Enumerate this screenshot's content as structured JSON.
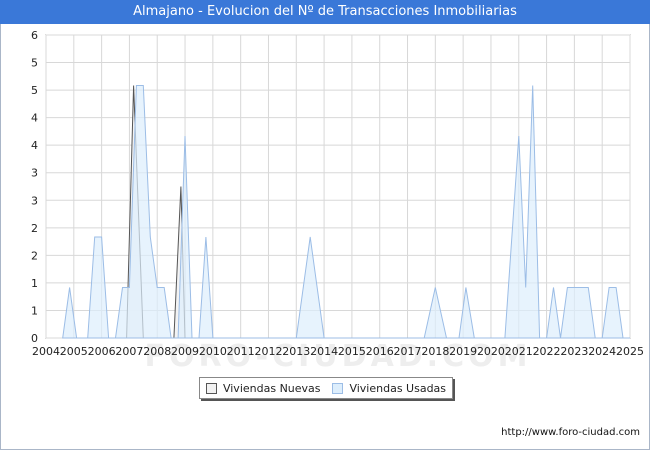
{
  "title": "Almajano - Evolucion del Nº de Transacciones Inmobiliarias",
  "footer": "http://www.foro-ciudad.com",
  "watermark": "FORO-CIUDAD.COM",
  "colors": {
    "title_bg": "#3a78d8",
    "nuevas_fill": "#f2f2f2",
    "nuevas_line": "#555555",
    "usadas_fill": "#ddeefc",
    "usadas_line": "#9cbde6",
    "grid": "#d8d8d8"
  },
  "chart_data": {
    "type": "area",
    "title": "Almajano - Evolucion del Nº de Transacciones Inmobiliarias",
    "xlabel": "",
    "ylabel": "",
    "xlim": [
      2004,
      2025
    ],
    "ylim": [
      0,
      6
    ],
    "x_ticks": [
      "2004",
      "2005",
      "2006",
      "2007",
      "2008",
      "2009",
      "2010",
      "2011",
      "2012",
      "2013",
      "2014",
      "2015",
      "2016",
      "2017",
      "2018",
      "2019",
      "2020",
      "2021",
      "2022",
      "2023",
      "2024",
      "2025"
    ],
    "y_tick_labels": [
      "0",
      "1",
      "1",
      "2",
      "2",
      "3",
      "3",
      "4",
      "4",
      "5",
      "5",
      "6"
    ],
    "grid": true,
    "legend_position": "bottom",
    "series": [
      {
        "name": "Viviendas Nuevas",
        "x": [
          2006.9,
          2007.15,
          2007.5,
          2008.6,
          2008.85,
          2009.0
        ],
        "y": [
          0,
          5,
          0,
          0,
          3,
          0
        ]
      },
      {
        "name": "Viviendas Usadas",
        "x": [
          2004.6,
          2004.85,
          2005.1,
          2005.5,
          2005.75,
          2006.0,
          2006.25,
          2006.5,
          2006.75,
          2007.0,
          2007.25,
          2007.5,
          2007.75,
          2008.0,
          2008.25,
          2008.5,
          2008.75,
          2009.0,
          2009.25,
          2009.5,
          2009.75,
          2010.0,
          2013.0,
          2013.5,
          2014.0,
          2017.6,
          2018.0,
          2018.4,
          2018.85,
          2019.1,
          2019.4,
          2020.5,
          2021.0,
          2021.25,
          2021.5,
          2021.75,
          2022.0,
          2022.25,
          2022.5,
          2022.75,
          2023.0,
          2023.25,
          2023.5,
          2023.75,
          2024.0,
          2024.25,
          2024.5,
          2024.75,
          2025.0
        ],
        "y": [
          0,
          1,
          0,
          0,
          2,
          2,
          0,
          0,
          1,
          1,
          5,
          5,
          2,
          1,
          1,
          0,
          0,
          4,
          0,
          0,
          2,
          0,
          0,
          2,
          0,
          0,
          1,
          0,
          0,
          1,
          0,
          0,
          4,
          1,
          5,
          0,
          0,
          1,
          0,
          1,
          1,
          1,
          1,
          0,
          0,
          1,
          1,
          0,
          0
        ]
      }
    ]
  },
  "legend": {
    "nuevas_label": "Viviendas Nuevas",
    "usadas_label": "Viviendas Usadas"
  }
}
